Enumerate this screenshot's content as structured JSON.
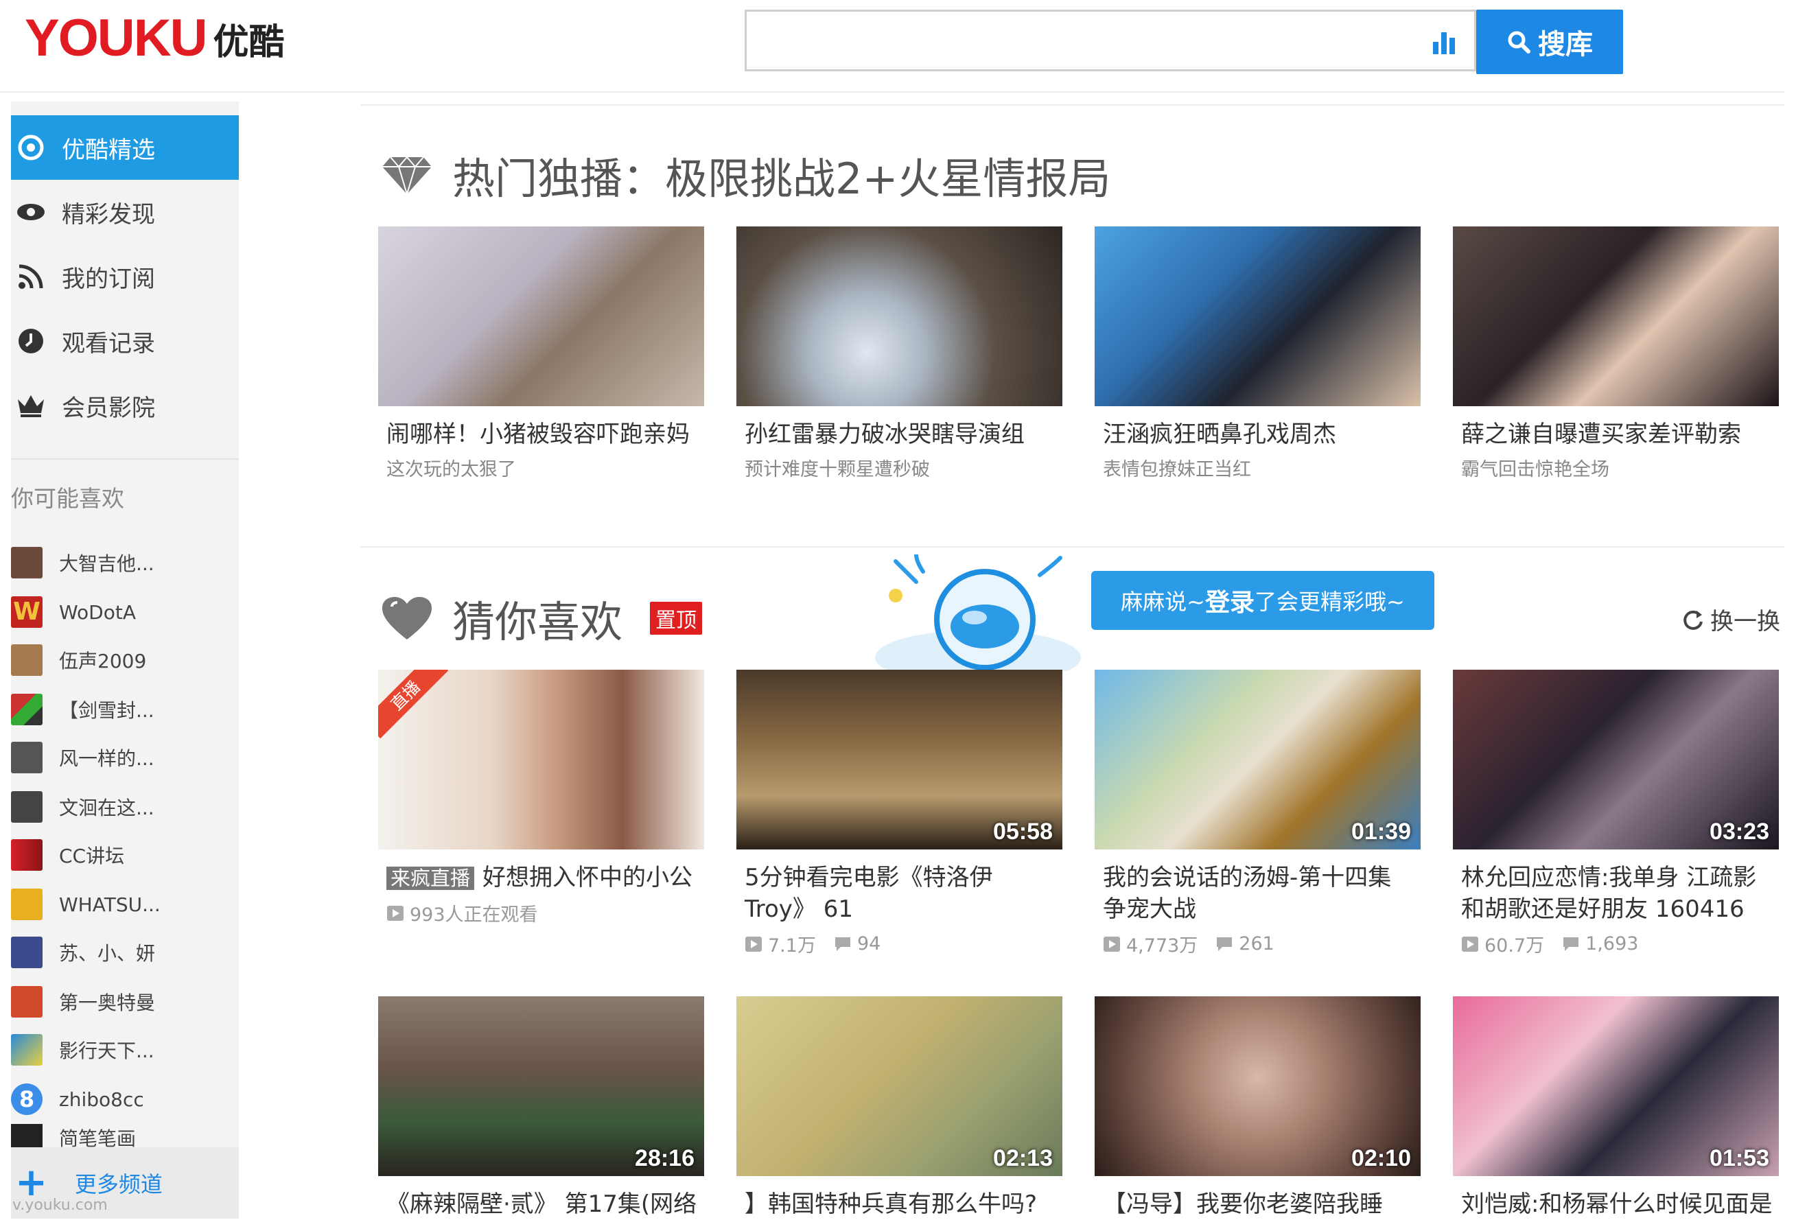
{
  "header": {
    "logo_en": "YOUKU",
    "logo_cn": "优酷",
    "search_value": "",
    "search_button": "搜库",
    "brand_color": "#1e88e5"
  },
  "sidebar": {
    "nav": [
      {
        "label": "优酷精选",
        "icon": "play-circle-icon",
        "active": true
      },
      {
        "label": "精彩发现",
        "icon": "eye-icon"
      },
      {
        "label": "我的订阅",
        "icon": "rss-icon"
      },
      {
        "label": "观看记录",
        "icon": "clock-icon"
      },
      {
        "label": "会员影院",
        "icon": "crown-icon"
      }
    ],
    "maybe_like_title": "你可能喜欢",
    "channels": [
      "大智吉他...",
      "WoDotA",
      "伍声2009",
      "【剑雪封...",
      "风一样的...",
      "文洄在这...",
      "CC讲坛",
      "WHATSU...",
      "苏、小、妍",
      "第一奥特曼",
      "影行天下...",
      "zhibo8cc",
      "简笔笔画"
    ],
    "more_channels": "更多频道",
    "url_text": "v.youku.com"
  },
  "section1": {
    "title": "热门独播：极限挑战2+火星情报局",
    "cards": [
      {
        "title": "闹哪样！小猪被毁容吓跑亲妈",
        "sub": "这次玩的太狠了"
      },
      {
        "title": "孙红雷暴力破冰哭瞎导演组",
        "sub": "预计难度十颗星遭秒破"
      },
      {
        "title": "汪涵疯狂晒鼻孔戏周杰",
        "sub": "表情包撩妹正当红"
      },
      {
        "title": "薛之谦自曝遭买家差评勒索",
        "sub": "霸气回击惊艳全场"
      }
    ]
  },
  "section2": {
    "title": "猜你喜欢",
    "badge": "置顶",
    "bubble_pre": "麻麻说~",
    "bubble_link": "登录",
    "bubble_post": "了会更精彩哦~",
    "refresh": "换一换",
    "cards": [
      {
        "live_tag": "来疯直播",
        "title": "好想拥入怀中的小公",
        "ribbon": "直播",
        "views": "993人正在观看"
      },
      {
        "title": "5分钟看完电影《特洛伊 Troy》 61",
        "duration": "05:58",
        "views": "7.1万",
        "comments": "94"
      },
      {
        "title": "我的会说话的汤姆-第十四集 争宠大战",
        "duration": "01:39",
        "views": "4,773万",
        "comments": "261"
      },
      {
        "title": "林允回应恋情:我单身 江疏影和胡歌还是好朋友 160416",
        "duration": "03:23",
        "views": "60.7万",
        "comments": "1,693"
      }
    ]
  },
  "section3": {
    "cards": [
      {
        "title": "《麻辣隔壁·贰》 第17集(网络",
        "duration": "28:16"
      },
      {
        "title": "】韩国特种兵真有那么牛吗?",
        "duration": "02:13"
      },
      {
        "title": "【冯导】我要你老婆陪我睡",
        "duration": "02:10"
      },
      {
        "title": "刘恺威:和杨幂什么时候见面是",
        "duration": "01:53"
      }
    ]
  }
}
